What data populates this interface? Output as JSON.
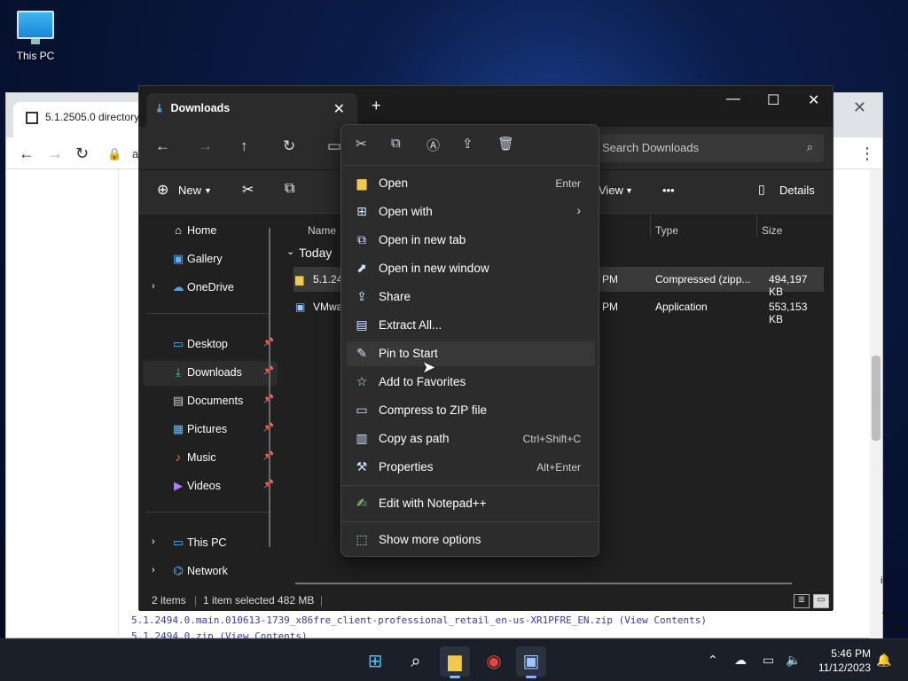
{
  "desktop": {
    "icon_label": "This PC"
  },
  "browser": {
    "tab_title": "5.1.2505.0 directory",
    "address_fragment": "a",
    "content_lines": [
      "5.1.2494.0.main.010613-1739_x86fre_client-professional_retail_en-us-XR1PFRE_EN.zip (View Contents)",
      "5.1.2494.0.zip (View Contents)"
    ],
    "side_texts": [
      "in",
      "view",
      "1416"
    ]
  },
  "explorer": {
    "tab_title": "Downloads",
    "search_placeholder": "Search Downloads",
    "toolbar": {
      "new_label": "New",
      "view_label": "View",
      "details_label": "Details",
      "more": "•••"
    },
    "nav": [
      {
        "label": "Home",
        "icon": "home-icon",
        "glyph": "⌂"
      },
      {
        "label": "Gallery",
        "icon": "gallery-icon",
        "glyph": "▣"
      },
      {
        "label": "OneDrive",
        "icon": "onedrive-icon",
        "glyph": "☁"
      },
      {
        "label": "Desktop",
        "icon": "desktop-folder-icon",
        "glyph": "▭"
      },
      {
        "label": "Downloads",
        "icon": "downloads-icon",
        "glyph": "⤓"
      },
      {
        "label": "Documents",
        "icon": "documents-icon",
        "glyph": "▤"
      },
      {
        "label": "Pictures",
        "icon": "pictures-icon",
        "glyph": "▦"
      },
      {
        "label": "Music",
        "icon": "music-icon",
        "glyph": "♪"
      },
      {
        "label": "Videos",
        "icon": "videos-icon",
        "glyph": "▶"
      },
      {
        "label": "This PC",
        "icon": "this-pc-icon",
        "glyph": "▭"
      },
      {
        "label": "Network",
        "icon": "network-icon",
        "glyph": "⌬"
      }
    ],
    "columns": {
      "name": "Name",
      "type": "Type",
      "size": "Size"
    },
    "group_label": "Today",
    "files": [
      {
        "name": "5.1.24",
        "date_suffix": "PM",
        "type": "Compressed (zipp...",
        "size": "494,197 KB"
      },
      {
        "name": "VMwa",
        "date_suffix": "PM",
        "type": "Application",
        "size": "553,153 KB"
      }
    ],
    "status": {
      "items": "2 items",
      "selected": "1 item selected  482 MB"
    }
  },
  "context_menu": {
    "items": [
      {
        "label": "Open",
        "shortcut": "Enter",
        "icon": "open-folder-icon",
        "glyph": "▆"
      },
      {
        "label": "Open with",
        "shortcut": "",
        "icon": "open-with-icon",
        "glyph": "⊞",
        "submenu": "›"
      },
      {
        "label": "Open in new tab",
        "shortcut": "",
        "icon": "new-tab-icon",
        "glyph": "⧉"
      },
      {
        "label": "Open in new window",
        "shortcut": "",
        "icon": "new-window-icon",
        "glyph": "⬈"
      },
      {
        "label": "Share",
        "shortcut": "",
        "icon": "share-icon",
        "glyph": "⇪"
      },
      {
        "label": "Extract All...",
        "shortcut": "",
        "icon": "extract-icon",
        "glyph": "▤"
      },
      {
        "label": "Pin to Start",
        "shortcut": "",
        "icon": "pin-icon",
        "glyph": "✎"
      },
      {
        "label": "Add to Favorites",
        "shortcut": "",
        "icon": "star-icon",
        "glyph": "☆"
      },
      {
        "label": "Compress to ZIP file",
        "shortcut": "",
        "icon": "zip-icon",
        "glyph": "▭"
      },
      {
        "label": "Copy as path",
        "shortcut": "Ctrl+Shift+C",
        "icon": "copy-path-icon",
        "glyph": "▥"
      },
      {
        "label": "Properties",
        "shortcut": "Alt+Enter",
        "icon": "properties-icon",
        "glyph": "⚒"
      },
      {
        "label": "Edit with Notepad++",
        "shortcut": "",
        "icon": "notepadpp-icon",
        "glyph": "✍"
      },
      {
        "label": "Show more options",
        "shortcut": "",
        "icon": "more-options-icon",
        "glyph": "⬚"
      }
    ]
  },
  "taskbar": {
    "time": "5:46 PM",
    "date": "11/12/2023"
  }
}
